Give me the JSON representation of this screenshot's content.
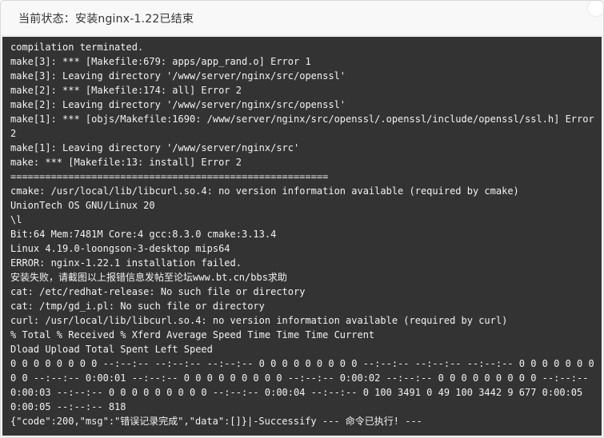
{
  "dialog": {
    "title": "当前状态：安装nginx-1.22已结束"
  },
  "terminal": {
    "lines": [
      "compilation terminated.",
      "make[3]: *** [Makefile:679: apps/app_rand.o] Error 1",
      "make[3]: Leaving directory '/www/server/nginx/src/openssl'",
      "make[2]: *** [Makefile:174: all] Error 2",
      "make[2]: Leaving directory '/www/server/nginx/src/openssl'",
      "make[1]: *** [objs/Makefile:1690: /www/server/nginx/src/openssl/.openssl/include/openssl/ssl.h] Error 2",
      "make[1]: Leaving directory '/www/server/nginx/src'",
      "make: *** [Makefile:13: install] Error 2",
      "=======================================================",
      "cmake: /usr/local/lib/libcurl.so.4: no version information available (required by cmake)",
      "UnionTech OS GNU/Linux 20",
      "\\l",
      "Bit:64 Mem:7481M Core:4 gcc:8.3.0 cmake:3.13.4",
      "Linux 4.19.0-loongson-3-desktop mips64",
      "ERROR: nginx-1.22.1 installation failed.",
      "安装失败，请截图以上报错信息发帖至论坛www.bt.cn/bbs求助",
      "cat: /etc/redhat-release: No such file or directory",
      "cat: /tmp/gd_i.pl: No such file or directory",
      "curl: /usr/local/lib/libcurl.so.4: no version information available (required by curl)",
      "% Total % Received % Xferd Average Speed Time Time Time Current",
      "Dload Upload Total Spent Left Speed",
      "0 0 0 0 0 0 0 0 --:--:-- --:--:-- --:--:-- 0 0 0 0 0 0 0 0 0 --:--:-- --:--:-- --:--:-- 0 0 0 0 0 0 0 0 0 --:--:-- 0:00:01 --:--:-- 0 0 0 0 0 0 0 0 0 --:--:-- 0:00:02 --:--:-- 0 0 0 0 0 0 0 0 0 --:--:-- 0:00:03 --:--:-- 0 0 0 0 0 0 0 0 0 --:--:-- 0:00:04 --:--:-- 0 100 3491 0 49 100 3442 9 677 0:00:05 0:00:05 --:--:-- 818",
      "{\"code\":200,\"msg\":\"错误记录完成\",\"data\":[]}|-Successify --- 命令已执行! ---"
    ]
  },
  "colors": {
    "terminal_bg": "#333333",
    "terminal_text": "#f2f2f2",
    "header_bg": "#f8f8f8",
    "title_text": "#333333"
  }
}
